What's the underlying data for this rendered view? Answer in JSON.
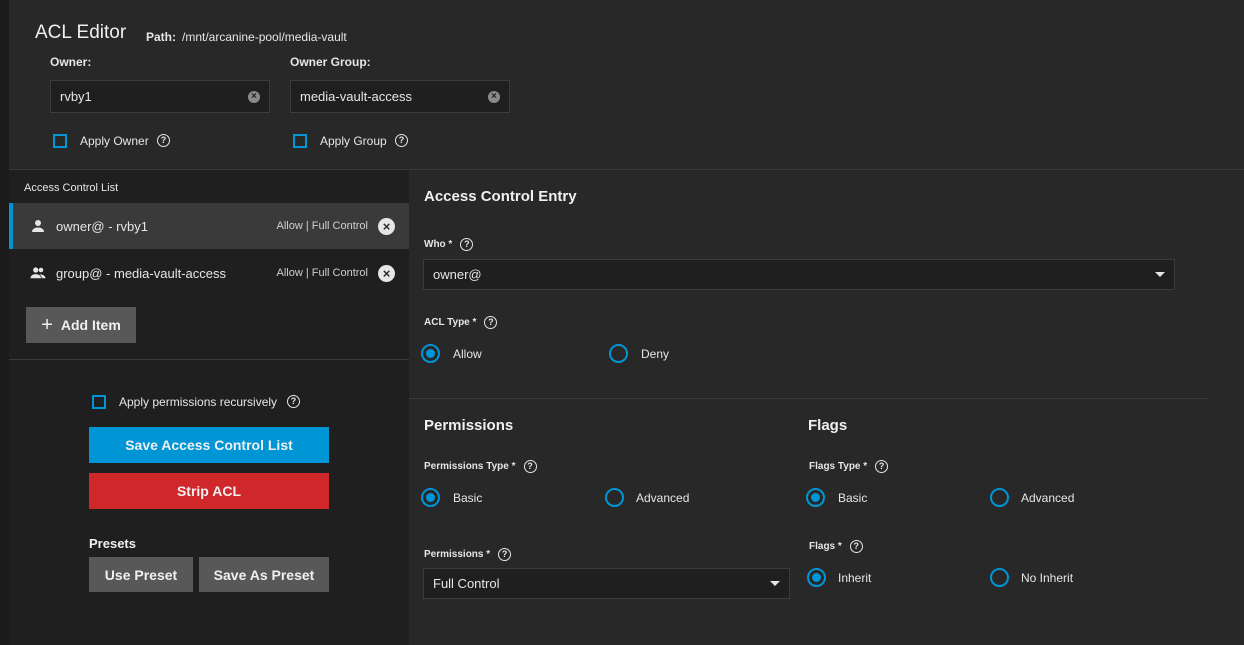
{
  "header": {
    "title": "ACL Editor",
    "path_label": "Path:",
    "path_value": "/mnt/arcanine-pool/media-vault"
  },
  "owner": {
    "label": "Owner:",
    "value": "rvby1",
    "apply_label": "Apply Owner"
  },
  "group": {
    "label": "Owner Group:",
    "value": "media-vault-access",
    "apply_label": "Apply Group"
  },
  "acl_list": {
    "title": "Access Control List",
    "items": [
      {
        "name": "owner@ - rvby1",
        "meta": "Allow | Full Control",
        "icon": "person-icon",
        "active": true
      },
      {
        "name": "group@ - media-vault-access",
        "meta": "Allow | Full Control",
        "icon": "group-icon",
        "active": false
      }
    ],
    "add_label": "Add Item"
  },
  "actions": {
    "recursive_label": "Apply permissions recursively",
    "save_label": "Save Access Control List",
    "strip_label": "Strip ACL",
    "presets_label": "Presets",
    "use_preset_label": "Use Preset",
    "save_preset_label": "Save As Preset"
  },
  "entry": {
    "title": "Access Control Entry",
    "who_label": "Who *",
    "who_value": "owner@",
    "acl_type_label": "ACL Type *",
    "allow_label": "Allow",
    "deny_label": "Deny"
  },
  "permissions": {
    "title": "Permissions",
    "type_label": "Permissions Type *",
    "basic_label": "Basic",
    "advanced_label": "Advanced",
    "perm_label": "Permissions *",
    "perm_value": "Full Control"
  },
  "flags": {
    "title": "Flags",
    "type_label": "Flags Type *",
    "basic_label": "Basic",
    "advanced_label": "Advanced",
    "flags_label": "Flags *",
    "inherit_label": "Inherit",
    "no_inherit_label": "No Inherit"
  },
  "colors": {
    "accent": "#0095d5",
    "danger": "#d0272a",
    "panel": "#282828",
    "list_bg": "#1f1f1f"
  }
}
